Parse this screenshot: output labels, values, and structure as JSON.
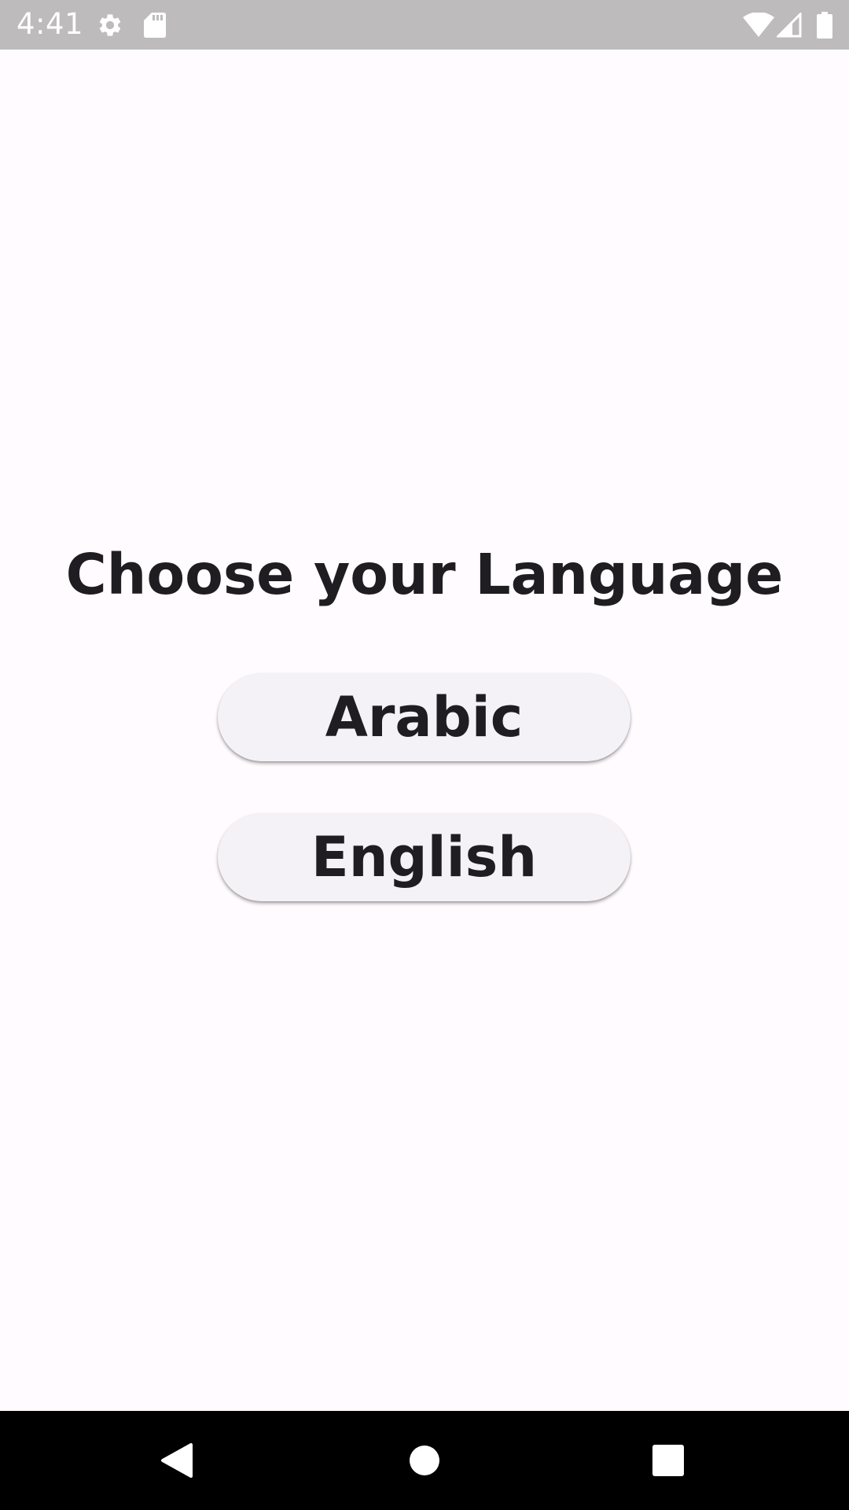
{
  "status_bar": {
    "time": "4:41",
    "icons": [
      "settings-icon",
      "sd-card-icon",
      "wifi-icon",
      "signal-icon",
      "battery-icon"
    ],
    "background": "#bdbbbc"
  },
  "main": {
    "title": "Choose your Language",
    "buttons": [
      {
        "label": "Arabic"
      },
      {
        "label": "English"
      }
    ],
    "background": "#fffbfe",
    "button_color": "#f5f2f7",
    "text_color": "#1f1c22"
  },
  "nav_bar": {
    "icons": [
      "back-icon",
      "home-icon",
      "recents-icon"
    ],
    "background": "#000000"
  }
}
